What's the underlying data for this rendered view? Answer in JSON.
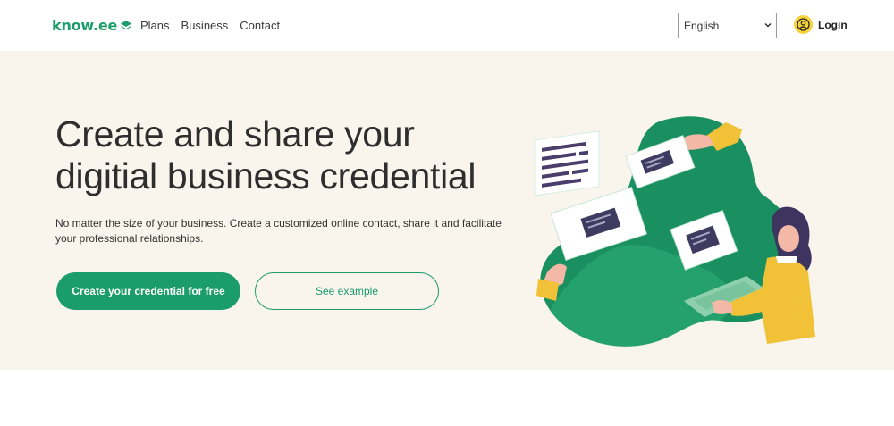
{
  "header": {
    "logo_text": "know.ee",
    "nav": [
      {
        "label": "Plans"
      },
      {
        "label": "Business"
      },
      {
        "label": "Contact"
      }
    ],
    "language": {
      "selected": "English"
    },
    "login_label": "Login"
  },
  "hero": {
    "title_line1": "Create and share your",
    "title_line2": "digitial business credential",
    "subtitle": "No matter the size of your business. Create a customized online contact, share it and facilitate your professional relationships.",
    "primary_button": "Create your credential for free",
    "secondary_button": "See example"
  },
  "colors": {
    "brand_green": "#1a9c6b",
    "hero_background": "#f9f5ed",
    "login_avatar": "#f6d23b"
  }
}
